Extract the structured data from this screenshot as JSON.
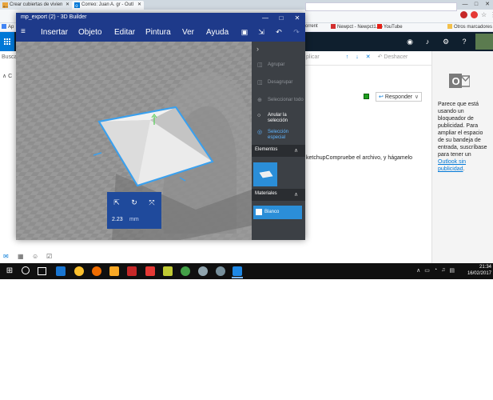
{
  "browser": {
    "tabs": [
      {
        "label": "Crear cubiertas de vivien"
      },
      {
        "label": "Correo: Juan A. gr - Outl"
      }
    ],
    "bookmarks": [
      {
        "label": "Ap"
      },
      {
        "label": "orrent"
      },
      {
        "label": "Newpct - Newpct1.co"
      },
      {
        "label": "YouTube"
      },
      {
        "label": "Otros marcadores"
      }
    ],
    "window_buttons": [
      "—",
      "□",
      "✕"
    ]
  },
  "outlook": {
    "search_label": "Busca",
    "folder_chevron": "∧",
    "folder_initial": "C",
    "commands": {
      "apply_label": "plicar",
      "undo_label": "Deshacer"
    },
    "reply_label": "Responder",
    "body_text": "ketchupCompruebe el archivo, y hágamelo",
    "ad": {
      "text_before_link": "Parece que está usando un bloqueador de publicidad. Para ampliar el espacio de su bandeja de entrada, suscríbase para tener un ",
      "link_text": "Outlook sin publicidad",
      "text_after_link": "."
    }
  },
  "builder": {
    "window_title": "mp_export (2) - 3D Builder",
    "menu": [
      {
        "label": "Insertar"
      },
      {
        "label": "Objeto"
      },
      {
        "label": "Editar"
      },
      {
        "label": "Pintura"
      },
      {
        "label": "Ver"
      },
      {
        "label": "Ayuda"
      }
    ],
    "side_actions": [
      {
        "label": "Agrupar",
        "enabled": false
      },
      {
        "label": "Desagrupar",
        "enabled": false
      },
      {
        "label": "Seleccionar todo",
        "enabled": false
      },
      {
        "label": "Anular la selección",
        "enabled": true
      },
      {
        "label": "Selección especial",
        "enabled": true
      }
    ],
    "elements_section": "Elementos",
    "materials_section": "Materiales",
    "material_name": "Blanco",
    "transform": {
      "value": "2.23",
      "unit": "mm"
    }
  },
  "taskbar": {
    "time": "21:34",
    "date": "16/02/2017"
  },
  "colors": {
    "builder_titlebar": "#1e3a8a",
    "builder_accent": "#2b8ed8",
    "outlook_topbar": "#0f1f2e",
    "outlook_link": "#0078d7",
    "taskbar": "#101010"
  }
}
